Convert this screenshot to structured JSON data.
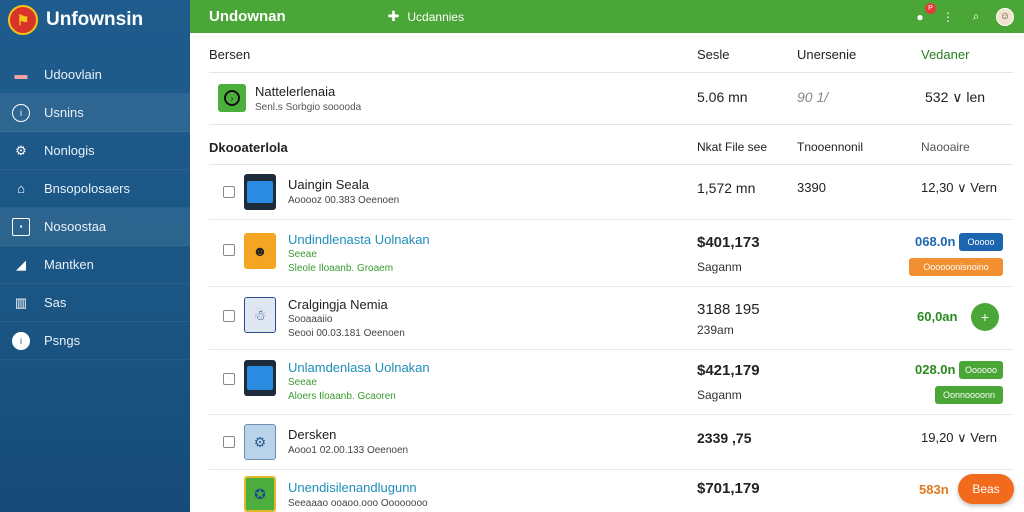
{
  "brand": {
    "title": "Unfownsin",
    "logo_icon": "flag-logo"
  },
  "sidebar": {
    "items": [
      {
        "label": "Udoovlain",
        "icon": "bag-icon"
      },
      {
        "label": "Usnins",
        "icon": "info-circle-icon"
      },
      {
        "label": "Nonlogis",
        "icon": "gear-icon"
      },
      {
        "label": "Bnsopolosaers",
        "icon": "store-icon"
      },
      {
        "label": "Nosoostaa",
        "icon": "square-icon"
      },
      {
        "label": "Mantken",
        "icon": "chart-icon"
      },
      {
        "label": "Sas",
        "icon": "columns-icon"
      },
      {
        "label": "Psngs",
        "icon": "info-icon"
      }
    ]
  },
  "topbar": {
    "app_name": "Undownan",
    "link_label": "Ucdannies",
    "notif_count": "P"
  },
  "header": {
    "col1": "Bersen",
    "col2": "Sesle",
    "col3": "Unersenie",
    "col4": "Vedaner"
  },
  "featured": {
    "title": "Nattelerlenaia",
    "subtitle": "Senl.s Sorbgio sooooda",
    "value1": "5.06 mn",
    "value2": "90 1/",
    "value3": "532 ∨ len"
  },
  "subheader": {
    "col1": "Dkooaterlola",
    "col2": "Nkat File see",
    "col3": "Tnooennonil",
    "col4": "Naooaire"
  },
  "rows": [
    {
      "title": "Uaingin Seala",
      "sub1": "Aooooz 00.383 Oeenoen",
      "size": "1,572 mn",
      "mid": "3390",
      "right": "12,30 ∨ Vern"
    },
    {
      "title": "Undindlenasta Uolnakan",
      "sub1": "Seeae",
      "sub2": "Sleole Iloaanb. Groaem",
      "price": "$401,173",
      "price_sub": "Saganm",
      "right": "068.0n",
      "btn1": "Ooooo",
      "btn2": "Oooooonisnoino"
    },
    {
      "title": "Cralgingja Nemia",
      "sub1": "Sooaaaiio",
      "sub2": "Seooi 00.03.181 Oeenoen",
      "price": "3188 195",
      "price_sub": "239am",
      "right": "60,0an",
      "btn1": "+"
    },
    {
      "title": "Unlamdenlasa Uolnakan",
      "sub1": "Seeae",
      "sub2": "Aloers Iloaanb. Gcaoren",
      "price": "$421,179",
      "price_sub": "Saganm",
      "right": "028.0n",
      "btn1": "Oooooo",
      "btn2": "Oonnoooonn"
    },
    {
      "title": "Dersken",
      "sub1": "Aooo1 02.00.133 Oeenoen",
      "size": "2339 ,75",
      "right": "19,20 ∨ Vern"
    },
    {
      "title": "Unendisilenandlugunn",
      "sub1": "Seeaaao ooaoo.ooo Oooooooo",
      "price": "$701,179",
      "right": "583n"
    }
  ],
  "fab": {
    "label": "Beas"
  },
  "colors": {
    "sidebar": "#1f5c8d",
    "topbar": "#4aa637",
    "accent_blue": "#1c66b0",
    "accent_orange": "#f28f2e",
    "accent_green": "#4aa637"
  }
}
